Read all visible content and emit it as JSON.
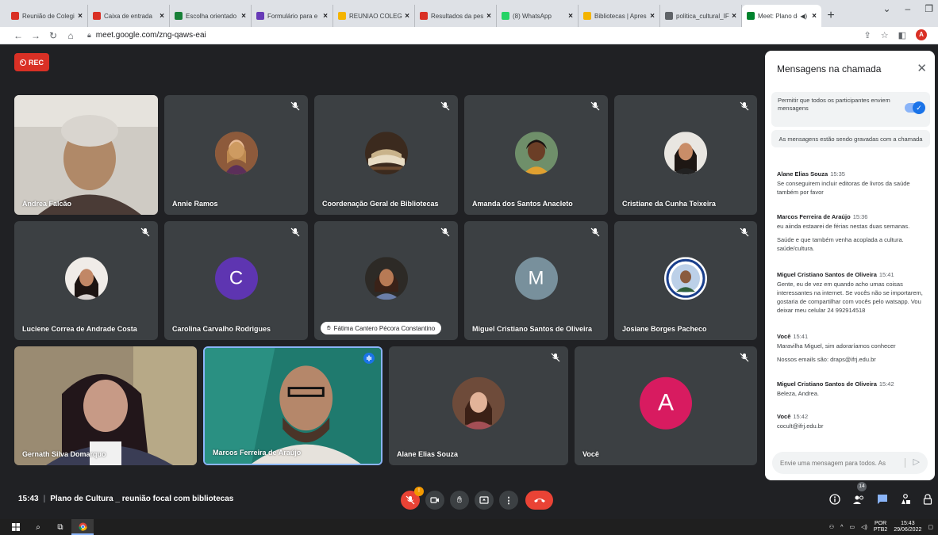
{
  "browser": {
    "tabs": [
      {
        "label": "Reunião de Colegi",
        "icon": "gmail-icon",
        "color": "#d93025"
      },
      {
        "label": "Caixa de entrada",
        "icon": "gmail-icon",
        "color": "#d93025"
      },
      {
        "label": "Escolha orientado",
        "icon": "sheets-icon",
        "color": "#188038"
      },
      {
        "label": "Formulário para e",
        "icon": "forms-icon",
        "color": "#673ab7"
      },
      {
        "label": "REUNIAO COLEGIA",
        "icon": "slides-icon",
        "color": "#f4b400"
      },
      {
        "label": "Resultados da pes",
        "icon": "gmail-icon",
        "color": "#d93025"
      },
      {
        "label": "(8) WhatsApp",
        "icon": "whatsapp-icon",
        "color": "#25d366"
      },
      {
        "label": "Bibliotecas | Apres",
        "icon": "slides-icon",
        "color": "#f4b400"
      },
      {
        "label": "politica_cultural_IF",
        "icon": "web-icon",
        "color": "#5f6368"
      }
    ],
    "active_tab": {
      "label": "Meet: Plano de",
      "icon": "meet-icon"
    },
    "url": "meet.google.com/zng-qaws-eai",
    "profile_initial": "A"
  },
  "meet": {
    "rec_label": "REC",
    "tiles_row1": [
      {
        "name": "Andrea Falcão"
      },
      {
        "name": "Annie Ramos"
      },
      {
        "name": "Coordenação Geral de Bibliotecas"
      },
      {
        "name": "Amanda dos Santos Anacleto"
      },
      {
        "name": "Cristiane da Cunha Teixeira"
      }
    ],
    "tiles_row2": [
      {
        "name": "Luciene Correa de Andrade Costa"
      },
      {
        "name": "Carolina Carvalho Rodrigues",
        "initial": "C"
      },
      {
        "name": "Fátima Cantero Pécora Constantino"
      },
      {
        "name": "Miguel Cristiano Santos de Oliveira",
        "initial": "M"
      },
      {
        "name": "Josiane Borges Pacheco"
      }
    ],
    "tiles_row3": [
      {
        "name": "Gernath Silva Domarquo"
      },
      {
        "name": "Marcos Ferreira de Araújo"
      },
      {
        "name": "Alane Elias Souza"
      },
      {
        "name": "Você",
        "initial": "A"
      }
    ],
    "time": "15:43",
    "meeting_title": "Plano de Cultura _ reunião focal com bibliotecas",
    "mic_badge": "!",
    "participant_count": "14"
  },
  "chat": {
    "title": "Mensagens na chamada",
    "permission_text": "Permitir que todos os participantes enviem mensagens",
    "recording_note": "As mensagens estão sendo gravadas com a chamada",
    "messages": [
      {
        "sender": "Alane Elias Souza",
        "time": "15:35",
        "lines": [
          "Se conseguirem incluir editoras de livros da saúde também por favor"
        ]
      },
      {
        "sender": "Marcos Ferreira de Araújo",
        "time": "15:36",
        "lines": [
          "eu aiinda estaarei de férias nestas duas semanas.",
          "Saúde e que também venha acoplada a cultura. saúde/cultura."
        ]
      },
      {
        "sender": "Miguel Cristiano Santos de Oliveira",
        "time": "15:41",
        "lines": [
          "Gente, eu de vez em quando acho umas coisas interessantes na internet. Se vocês não se importarem, gostaria de compartilhar com vocês pelo watsapp. Vou deixar meu celular 24 992914518"
        ]
      },
      {
        "sender": "Você",
        "time": "15:41",
        "lines": [
          "Maravilha Miguel, sim adoraríamos conhecer",
          "Nossos emails são: draps@ifrj.edu.br"
        ]
      },
      {
        "sender": "Miguel Cristiano Santos de Oliveira",
        "time": "15:42",
        "lines": [
          "Beleza, Andrea."
        ]
      },
      {
        "sender": "Você",
        "time": "15:42",
        "lines": [
          "cocult@ifrj.edu.br"
        ]
      }
    ],
    "input_placeholder": "Envie uma mensagem para todos. As"
  },
  "taskbar": {
    "lang_top": "POR",
    "lang_bottom": "PTB2",
    "clock_time": "15:43",
    "clock_date": "29/06/2022"
  }
}
